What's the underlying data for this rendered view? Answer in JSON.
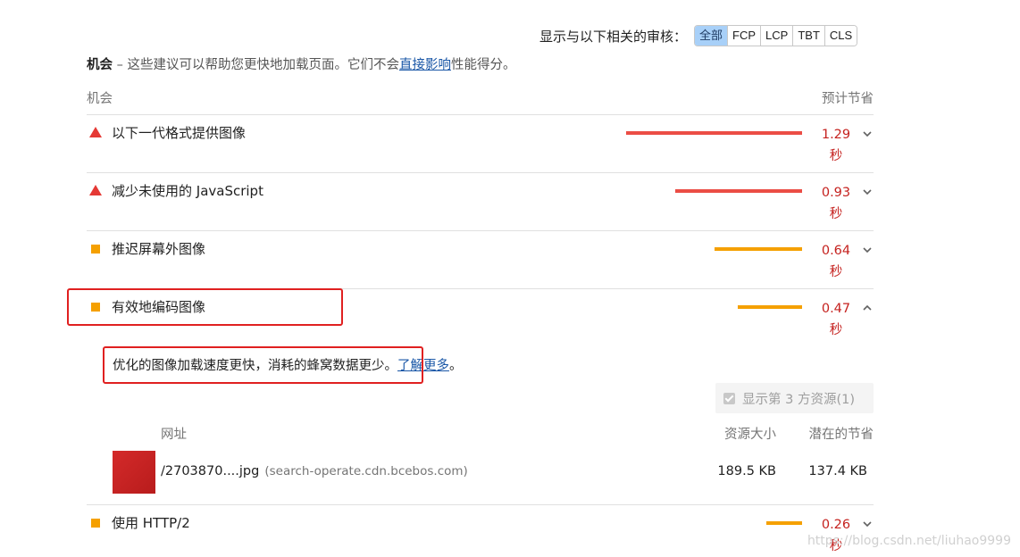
{
  "filter": {
    "label": "显示与以下相关的审核：",
    "buttons": [
      "全部",
      "FCP",
      "LCP",
      "TBT",
      "CLS"
    ],
    "active": "全部"
  },
  "section": {
    "title": "机会",
    "desc_prefix": " – 这些建议可以帮助您更快地加载页面。它们不会",
    "link": "直接影响",
    "desc_suffix": "性能得分。"
  },
  "columns": {
    "left": "机会",
    "right": "预计节省"
  },
  "opportunities": [
    {
      "label": "以下一代格式提供图像",
      "value": "1.29",
      "unit": "秒",
      "severity": "fail",
      "savings_s": 1.29
    },
    {
      "label": "减少未使用的 JavaScript",
      "value": "0.93",
      "unit": "秒",
      "severity": "fail",
      "savings_s": 0.93
    },
    {
      "label": "推迟屏幕外图像",
      "value": "0.64",
      "unit": "秒",
      "severity": "average",
      "savings_s": 0.64
    },
    {
      "label": "有效地编码图像",
      "value": "0.47",
      "unit": "秒",
      "severity": "average",
      "savings_s": 0.47,
      "expanded": true
    },
    {
      "label": "使用 HTTP/2",
      "value": "0.26",
      "unit": "秒",
      "severity": "average",
      "savings_s": 0.26
    }
  ],
  "detail": {
    "description": "优化的图像加载速度更快，消耗的蜂窝数据更少。",
    "learn_more": "了解更多",
    "period": "。",
    "third_party_label": "显示第 3 方资源(1)",
    "table_headers": {
      "url": "网址",
      "size": "资源大小",
      "savings": "潜在的节省"
    },
    "rows": [
      {
        "url": "/2703870....jpg",
        "host": "(search-operate.cdn.bcebos.com)",
        "size": "189.5 KB",
        "savings": "137.4 KB"
      }
    ]
  },
  "colors": {
    "fail": "#eb4d45",
    "average": "#f5a000",
    "value_text": "#c5221f",
    "highlight": "#e02020",
    "link": "#1a57a7"
  },
  "watermark": "https://blog.csdn.net/liuhao9999"
}
